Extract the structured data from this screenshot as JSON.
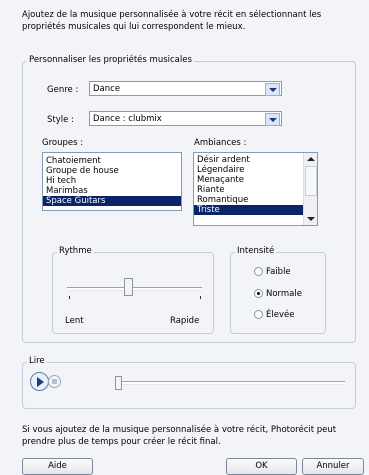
{
  "intro_text": "Ajoutez de la musique personnalisée à votre récit en sélectionnant les propriétés musicales qui lui correspondent le mieux.",
  "customize_group": {
    "title": "Personnaliser les propriétés musicales",
    "genre_label": "Genre :",
    "genre_value": "Dance",
    "style_label": "Style :",
    "style_value": "Dance : clubmix",
    "groups_label": "Groupes :",
    "groups": [
      "Chatoiement",
      "Groupe de house",
      "Hi tech",
      "Marimbas",
      "Space Guitars"
    ],
    "groups_selected": "Space Guitars",
    "moods_label": "Ambiances :",
    "moods": [
      "Désir ardent",
      "Légendaire",
      "Menaçante",
      "Riante",
      "Romantique",
      "Triste"
    ],
    "moods_selected": "Triste",
    "rhythm": {
      "title": "Rythme",
      "min_label": "Lent",
      "max_label": "Rapide",
      "value_fraction": 0.45
    },
    "intensity": {
      "title": "Intensité",
      "options": [
        "Faible",
        "Normale",
        "Élevée"
      ],
      "selected": "Normale"
    }
  },
  "play_group": {
    "title": "Lire",
    "position_fraction": 0.0
  },
  "note_text": "Si vous ajoutez de la musique personnalisée à votre récit, Photorécit peut prendre plus de temps pour créer le récit final.",
  "buttons": {
    "help": "Aide",
    "ok": "OK",
    "cancel": "Annuler"
  },
  "icons": {
    "play": "play-icon",
    "stop": "stop-icon",
    "dropdown": "chevron-down-icon"
  }
}
